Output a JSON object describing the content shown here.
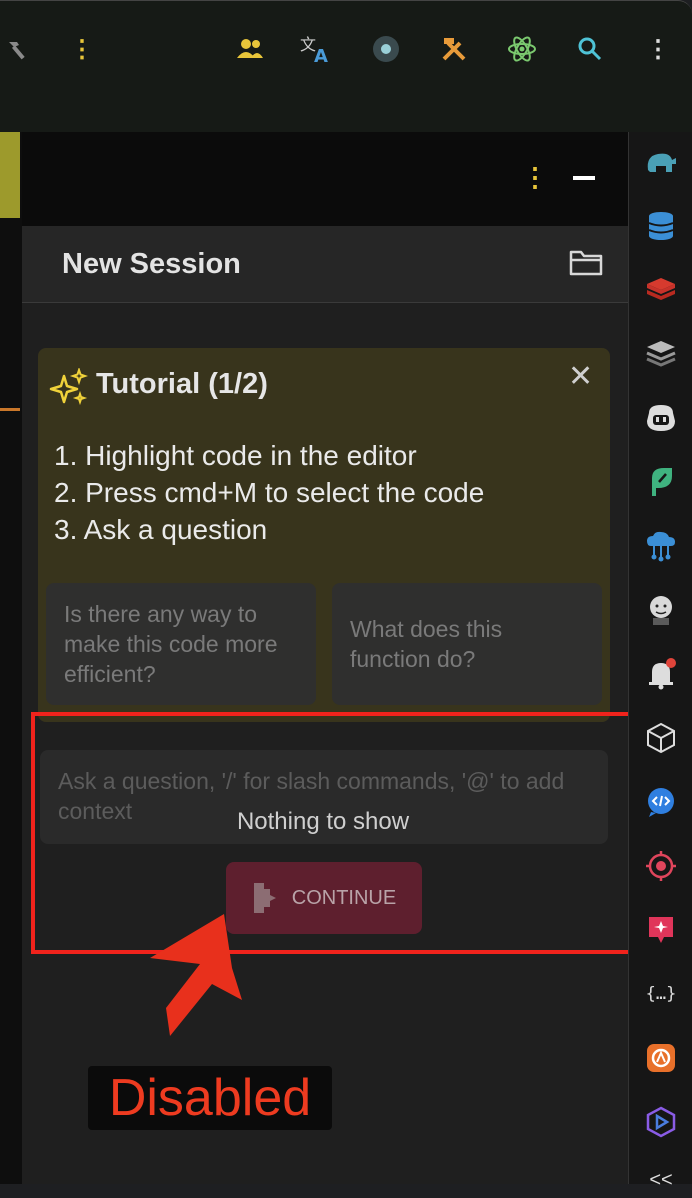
{
  "toolbar": {
    "icons": [
      "hammer-icon",
      "more-vertical-icon",
      "users-icon",
      "translate-icon",
      "record-icon",
      "tools-icon",
      "atom-icon",
      "search-icon",
      "more-vertical-icon"
    ]
  },
  "panel": {
    "session_title": "New Session",
    "tutorial": {
      "title": "Tutorial (1/2)",
      "steps": [
        "1. Highlight code in the editor",
        "2. Press cmd+M to select the code",
        "3. Ask a question"
      ],
      "suggestions": [
        "Is there any way to make this code more efficient?",
        "What does this function do?"
      ]
    },
    "input": {
      "placeholder": "Ask a question, '/' for slash commands, '@' to add context"
    },
    "empty_message": "Nothing to show",
    "continue_label": "CONTINUE"
  },
  "annotation": {
    "label": "Disabled",
    "color": "#ee3b20"
  },
  "sidebar": {
    "icons": [
      "gradle-elephant-icon",
      "database-icon",
      "redis-icon",
      "layers-icon",
      "copilot-icon",
      "feather-icon",
      "cloud-network-icon",
      "jenkins-icon",
      "notifications-icon",
      "cube-icon",
      "code-chat-icon",
      "target-icon",
      "sparkle-card-icon",
      "json-braces-icon",
      "plugin-icon",
      "hexagon-play-icon"
    ]
  },
  "colors": {
    "accent_yellow": "#e8c53a",
    "tutorial_bg": "#38341c",
    "continue_bg": "#5e1f2e",
    "highlight_red": "#f0231c"
  }
}
